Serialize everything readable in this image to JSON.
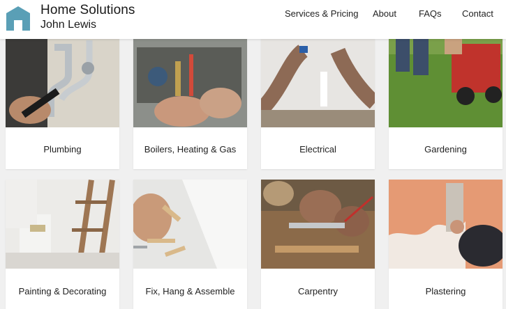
{
  "brand": {
    "title": "Home Solutions",
    "subtitle": "John Lewis"
  },
  "nav": [
    {
      "label": "Services & Pricing"
    },
    {
      "label": "About"
    },
    {
      "label": "FAQs"
    },
    {
      "label": "Contact"
    }
  ],
  "services": [
    {
      "label": "Plumbing"
    },
    {
      "label": "Boilers, Heating & Gas"
    },
    {
      "label": "Electrical"
    },
    {
      "label": "Gardening"
    },
    {
      "label": "Painting & Decorating"
    },
    {
      "label": "Fix, Hang & Assemble"
    },
    {
      "label": "Carpentry"
    },
    {
      "label": "Plastering"
    }
  ],
  "colors": {
    "logo": "#5a9fb6",
    "background": "#f0f0f0"
  }
}
